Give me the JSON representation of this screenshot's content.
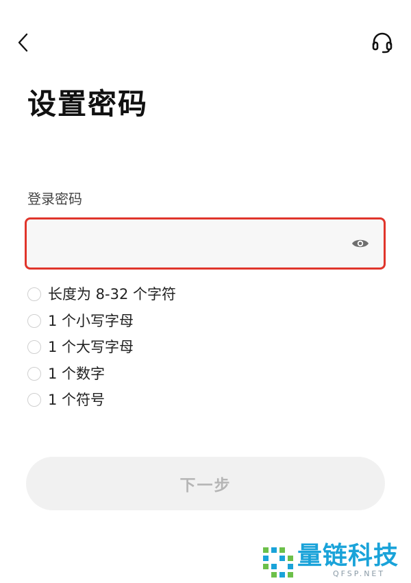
{
  "header": {
    "back_icon": "chevron-left",
    "support_icon": "headset"
  },
  "page": {
    "title": "设置密码"
  },
  "password_field": {
    "label": "登录密码",
    "value": "",
    "placeholder": "",
    "toggle_icon": "eye",
    "highlight_color": "#e0352b"
  },
  "rules": [
    {
      "text": "长度为 8-32 个字符",
      "met": false
    },
    {
      "text": "1 个小写字母",
      "met": false
    },
    {
      "text": "1 个大写字母",
      "met": false
    },
    {
      "text": "1 个数字",
      "met": false
    },
    {
      "text": "1 个符号",
      "met": false
    }
  ],
  "next_button": {
    "label": "下一步",
    "enabled": false
  },
  "watermark": {
    "text": "量链科技",
    "subtext": "QFSP.NET",
    "color": "#1aa3d9"
  }
}
